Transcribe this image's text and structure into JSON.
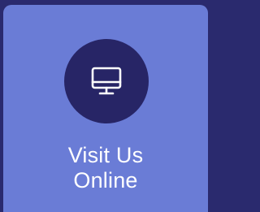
{
  "card": {
    "icon": "monitor-icon",
    "label_line1": "Visit Us",
    "label_line2": "Online"
  },
  "colors": {
    "background": "#2a2a6e",
    "card": "#6a7cd6",
    "icon_circle": "#272566",
    "text": "#ffffff"
  }
}
